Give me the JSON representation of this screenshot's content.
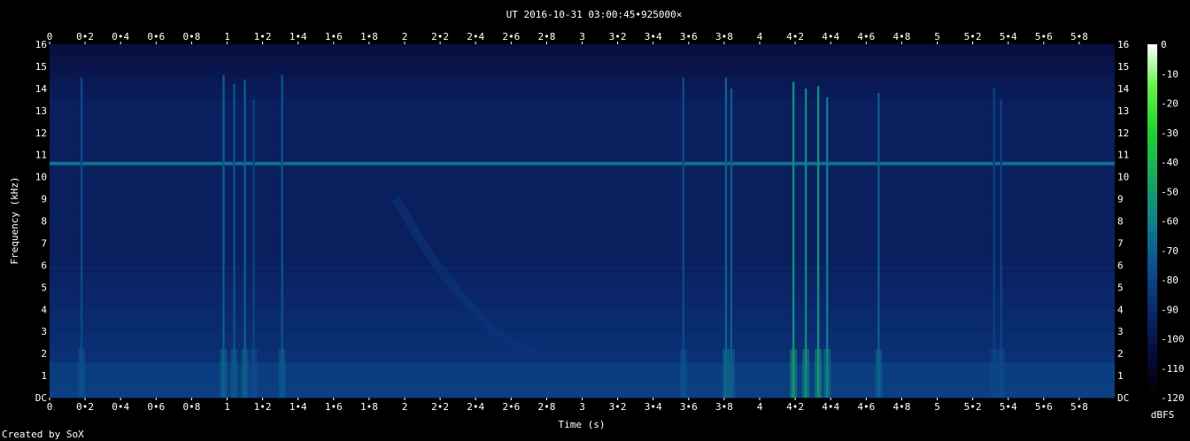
{
  "chart_data": {
    "type": "heatmap",
    "title": "UT 2016-10-31 03:00:45•925000×",
    "xlabel": "Time (s)",
    "ylabel": "Frequency (kHz)",
    "xlim": [
      0,
      6
    ],
    "ylim": [
      0,
      16
    ],
    "x_ticks": [
      "0",
      "0•2",
      "0•4",
      "0•6",
      "0•8",
      "1",
      "1•2",
      "1•4",
      "1•6",
      "1•8",
      "2",
      "2•2",
      "2•4",
      "2•6",
      "2•8",
      "3",
      "3•2",
      "3•4",
      "3•6",
      "3•8",
      "4",
      "4•2",
      "4•4",
      "4•6",
      "4•8",
      "5",
      "5•2",
      "5•4",
      "5•6",
      "5•8"
    ],
    "y_ticks": [
      "DC",
      "1",
      "2",
      "3",
      "4",
      "5",
      "6",
      "7",
      "8",
      "9",
      "10",
      "11",
      "12",
      "13",
      "14",
      "15",
      "16"
    ],
    "colorbar": {
      "label": "dBFS",
      "range": [
        -120,
        0
      ],
      "ticks": [
        "0",
        "-10",
        "-20",
        "-30",
        "-40",
        "-50",
        "-60",
        "-70",
        "-80",
        "-90",
        "-100",
        "-110",
        "-120"
      ],
      "colors": [
        "#000000",
        "#080a3a",
        "#0a2a70",
        "#0c5090",
        "#10808a",
        "#1aa860",
        "#20d030",
        "#60f040",
        "#ffffff"
      ]
    },
    "features": {
      "background_db": -95,
      "tone_khz": 10.6,
      "tone_db": -65,
      "low_band_khz": [
        0,
        1.6
      ],
      "low_band_db": -80,
      "impulses": [
        {
          "t": 0.18,
          "f_max": 14.5,
          "db": -78
        },
        {
          "t": 0.98,
          "f_max": 14.6,
          "db": -72
        },
        {
          "t": 1.04,
          "f_max": 14.2,
          "db": -75
        },
        {
          "t": 1.1,
          "f_max": 14.4,
          "db": -72
        },
        {
          "t": 1.15,
          "f_max": 13.5,
          "db": -80
        },
        {
          "t": 1.31,
          "f_max": 14.6,
          "db": -75
        },
        {
          "t": 3.57,
          "f_max": 14.5,
          "db": -78
        },
        {
          "t": 3.81,
          "f_max": 14.5,
          "db": -70
        },
        {
          "t": 3.84,
          "f_max": 14.0,
          "db": -72
        },
        {
          "t": 4.19,
          "f_max": 14.3,
          "db": -55
        },
        {
          "t": 4.26,
          "f_max": 14.0,
          "db": -58
        },
        {
          "t": 4.33,
          "f_max": 14.1,
          "db": -55
        },
        {
          "t": 4.38,
          "f_max": 13.6,
          "db": -62
        },
        {
          "t": 4.67,
          "f_max": 13.8,
          "db": -72
        },
        {
          "t": 5.32,
          "f_max": 14.0,
          "db": -82
        },
        {
          "t": 5.36,
          "f_max": 13.5,
          "db": -80
        }
      ],
      "sweep": {
        "t_start": 1.95,
        "f_start": 9.0,
        "t_end": 2.75,
        "f_end": 2.0,
        "db": -85
      }
    }
  },
  "footer": {
    "credit": "Created by SoX"
  }
}
